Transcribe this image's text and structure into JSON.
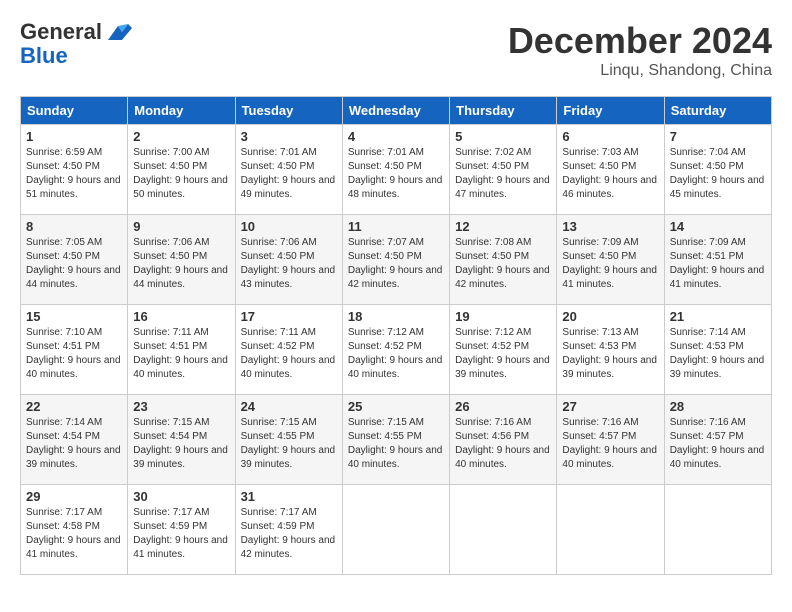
{
  "header": {
    "logo_general": "General",
    "logo_blue": "Blue",
    "month": "December 2024",
    "location": "Linqu, Shandong, China"
  },
  "weekdays": [
    "Sunday",
    "Monday",
    "Tuesday",
    "Wednesday",
    "Thursday",
    "Friday",
    "Saturday"
  ],
  "weeks": [
    [
      {
        "day": "1",
        "sunrise": "6:59 AM",
        "sunset": "4:50 PM",
        "daylight": "9 hours and 51 minutes."
      },
      {
        "day": "2",
        "sunrise": "7:00 AM",
        "sunset": "4:50 PM",
        "daylight": "9 hours and 50 minutes."
      },
      {
        "day": "3",
        "sunrise": "7:01 AM",
        "sunset": "4:50 PM",
        "daylight": "9 hours and 49 minutes."
      },
      {
        "day": "4",
        "sunrise": "7:01 AM",
        "sunset": "4:50 PM",
        "daylight": "9 hours and 48 minutes."
      },
      {
        "day": "5",
        "sunrise": "7:02 AM",
        "sunset": "4:50 PM",
        "daylight": "9 hours and 47 minutes."
      },
      {
        "day": "6",
        "sunrise": "7:03 AM",
        "sunset": "4:50 PM",
        "daylight": "9 hours and 46 minutes."
      },
      {
        "day": "7",
        "sunrise": "7:04 AM",
        "sunset": "4:50 PM",
        "daylight": "9 hours and 45 minutes."
      }
    ],
    [
      {
        "day": "8",
        "sunrise": "7:05 AM",
        "sunset": "4:50 PM",
        "daylight": "9 hours and 44 minutes."
      },
      {
        "day": "9",
        "sunrise": "7:06 AM",
        "sunset": "4:50 PM",
        "daylight": "9 hours and 44 minutes."
      },
      {
        "day": "10",
        "sunrise": "7:06 AM",
        "sunset": "4:50 PM",
        "daylight": "9 hours and 43 minutes."
      },
      {
        "day": "11",
        "sunrise": "7:07 AM",
        "sunset": "4:50 PM",
        "daylight": "9 hours and 42 minutes."
      },
      {
        "day": "12",
        "sunrise": "7:08 AM",
        "sunset": "4:50 PM",
        "daylight": "9 hours and 42 minutes."
      },
      {
        "day": "13",
        "sunrise": "7:09 AM",
        "sunset": "4:50 PM",
        "daylight": "9 hours and 41 minutes."
      },
      {
        "day": "14",
        "sunrise": "7:09 AM",
        "sunset": "4:51 PM",
        "daylight": "9 hours and 41 minutes."
      }
    ],
    [
      {
        "day": "15",
        "sunrise": "7:10 AM",
        "sunset": "4:51 PM",
        "daylight": "9 hours and 40 minutes."
      },
      {
        "day": "16",
        "sunrise": "7:11 AM",
        "sunset": "4:51 PM",
        "daylight": "9 hours and 40 minutes."
      },
      {
        "day": "17",
        "sunrise": "7:11 AM",
        "sunset": "4:52 PM",
        "daylight": "9 hours and 40 minutes."
      },
      {
        "day": "18",
        "sunrise": "7:12 AM",
        "sunset": "4:52 PM",
        "daylight": "9 hours and 40 minutes."
      },
      {
        "day": "19",
        "sunrise": "7:12 AM",
        "sunset": "4:52 PM",
        "daylight": "9 hours and 39 minutes."
      },
      {
        "day": "20",
        "sunrise": "7:13 AM",
        "sunset": "4:53 PM",
        "daylight": "9 hours and 39 minutes."
      },
      {
        "day": "21",
        "sunrise": "7:14 AM",
        "sunset": "4:53 PM",
        "daylight": "9 hours and 39 minutes."
      }
    ],
    [
      {
        "day": "22",
        "sunrise": "7:14 AM",
        "sunset": "4:54 PM",
        "daylight": "9 hours and 39 minutes."
      },
      {
        "day": "23",
        "sunrise": "7:15 AM",
        "sunset": "4:54 PM",
        "daylight": "9 hours and 39 minutes."
      },
      {
        "day": "24",
        "sunrise": "7:15 AM",
        "sunset": "4:55 PM",
        "daylight": "9 hours and 39 minutes."
      },
      {
        "day": "25",
        "sunrise": "7:15 AM",
        "sunset": "4:55 PM",
        "daylight": "9 hours and 40 minutes."
      },
      {
        "day": "26",
        "sunrise": "7:16 AM",
        "sunset": "4:56 PM",
        "daylight": "9 hours and 40 minutes."
      },
      {
        "day": "27",
        "sunrise": "7:16 AM",
        "sunset": "4:57 PM",
        "daylight": "9 hours and 40 minutes."
      },
      {
        "day": "28",
        "sunrise": "7:16 AM",
        "sunset": "4:57 PM",
        "daylight": "9 hours and 40 minutes."
      }
    ],
    [
      {
        "day": "29",
        "sunrise": "7:17 AM",
        "sunset": "4:58 PM",
        "daylight": "9 hours and 41 minutes."
      },
      {
        "day": "30",
        "sunrise": "7:17 AM",
        "sunset": "4:59 PM",
        "daylight": "9 hours and 41 minutes."
      },
      {
        "day": "31",
        "sunrise": "7:17 AM",
        "sunset": "4:59 PM",
        "daylight": "9 hours and 42 minutes."
      },
      null,
      null,
      null,
      null
    ]
  ],
  "labels": {
    "sunrise": "Sunrise: ",
    "sunset": "Sunset: ",
    "daylight": "Daylight: "
  }
}
